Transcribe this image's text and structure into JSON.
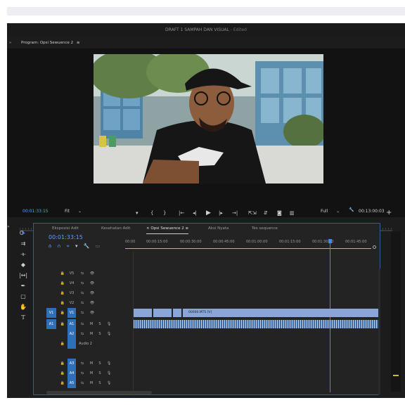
{
  "window": {
    "title": "DRAFT 1 SAMPAH DAN VISUAL",
    "edited": " - Edited"
  },
  "program_monitor": {
    "header_prefix": "Program: ",
    "sequence": "Opsi Sewuence 2",
    "menu_glyph": "≡",
    "expand_glyph": "»",
    "current_time": "00:01:33:15",
    "fit": "Fit",
    "quality": "Full",
    "duration": "00:13:00:03",
    "playhead_fraction": 0.17,
    "out_fraction": 0.88
  },
  "transport": {
    "marker": "▾",
    "in": "{",
    "out": "}",
    "go_in": "|←",
    "step_back": "◂|",
    "play": "▶",
    "step_fwd": "|▸",
    "go_out": "→|",
    "lift": "⇱⇲",
    "extract": "⇵",
    "export": "◙",
    "compare": "▥",
    "add": "+"
  },
  "timeline": {
    "tabs": [
      "Eksposisi Adit",
      "Kesehatan Adit",
      "Opsi Sewuence 2",
      "Aksi Nyata",
      "Tes sequence"
    ],
    "active_tab": 2,
    "close_glyph": "×",
    "menu_glyph": "≡",
    "current_time": "00:01:33:15",
    "ruler": [
      "00:00",
      "00:00:15:00",
      "00:00:30:00",
      "00:00:45:00",
      "00:01:00:00",
      "00:01:15:00",
      "00:01:30:00",
      "00:01:45:00"
    ],
    "playhead_fraction": 0.83,
    "video_tracks": [
      {
        "name": "V5"
      },
      {
        "name": "V4"
      },
      {
        "name": "V3"
      },
      {
        "name": "V2"
      },
      {
        "name": "V1",
        "source": "V1"
      }
    ],
    "audio_tracks": [
      {
        "name": "A1",
        "source": "A1",
        "label": ""
      },
      {
        "name": "A2",
        "label": "Audio 2"
      },
      {
        "name": "A3",
        "label": ""
      },
      {
        "name": "A4",
        "label": ""
      },
      {
        "name": "A5",
        "label": ""
      }
    ],
    "v1_clip_label": "00000.MTS [V]",
    "track_icons": {
      "lock": "🔒",
      "sync": "⇆",
      "eye": "👁",
      "mute": "M",
      "solo": "S",
      "mic": "🎙"
    }
  },
  "tools": [
    "selection",
    "track-select",
    "ripple-edit",
    "razor",
    "slip",
    "pen",
    "rectangle",
    "hand",
    "type"
  ],
  "colors": {
    "accent": "#2d8ceb",
    "timecode": "#5aa0ff",
    "clip_blue": "#8aa6d8",
    "audio_clip": "#3e6aa8",
    "bg": "#1c1c1c"
  }
}
